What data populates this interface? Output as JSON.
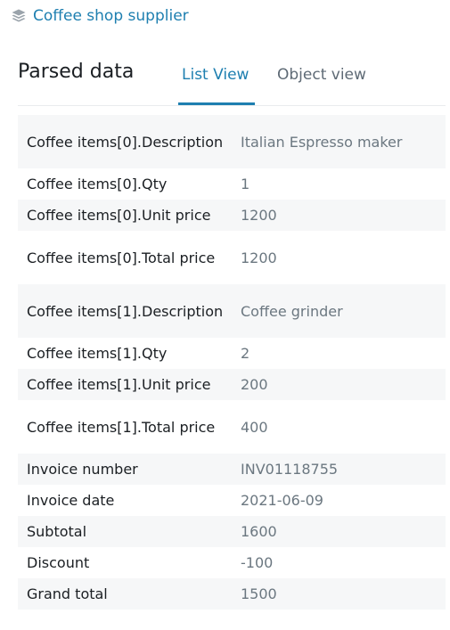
{
  "header": {
    "icon": "layers-icon",
    "link_text": "Coffee shop supplier",
    "link_color": "#1e7fb0"
  },
  "panel": {
    "title": "Parsed data",
    "tabs": [
      {
        "label": "List View",
        "active": true
      },
      {
        "label": "Object view",
        "active": false
      }
    ]
  },
  "rows": [
    {
      "key": "Coffee items[0].Description",
      "value": "Italian Espresso maker"
    },
    {
      "key": "Coffee items[0].Qty",
      "value": "1"
    },
    {
      "key": "Coffee items[0].Unit price",
      "value": "1200"
    },
    {
      "key": "Coffee items[0].Total price",
      "value": "1200"
    },
    {
      "key": "Coffee items[1].Description",
      "value": "Coffee grinder"
    },
    {
      "key": "Coffee items[1].Qty",
      "value": "2"
    },
    {
      "key": "Coffee items[1].Unit price",
      "value": "200"
    },
    {
      "key": "Coffee items[1].Total price",
      "value": "400"
    },
    {
      "key": "Invoice number",
      "value": "INV01118755"
    },
    {
      "key": "Invoice date",
      "value": "2021-06-09"
    },
    {
      "key": "Subtotal",
      "value": "1600"
    },
    {
      "key": "Discount",
      "value": "-100"
    },
    {
      "key": "Grand total",
      "value": "1500"
    }
  ]
}
